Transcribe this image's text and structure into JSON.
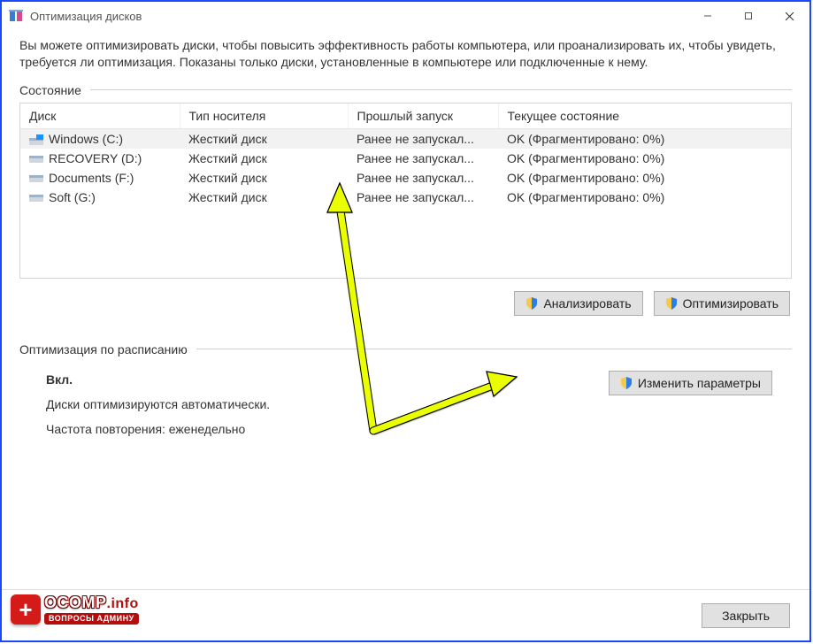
{
  "window": {
    "title": "Оптимизация дисков"
  },
  "description": "Вы можете оптимизировать диски, чтобы повысить эффективность работы  компьютера, или проанализировать их, чтобы увидеть, требуется ли оптимизация. Показаны только диски, установленные в компьютере или подключенные к нему.",
  "sections": {
    "status_label": "Состояние",
    "schedule_label": "Оптимизация по расписанию"
  },
  "table": {
    "headers": {
      "disk": "Диск",
      "media": "Тип носителя",
      "last": "Прошлый запуск",
      "state": "Текущее состояние"
    },
    "rows": [
      {
        "name": "Windows (C:)",
        "media": "Жесткий диск",
        "last": "Ранее не запускал...",
        "state": "OK (Фрагментировано: 0%)",
        "selected": true,
        "accent": true
      },
      {
        "name": "RECOVERY (D:)",
        "media": "Жесткий диск",
        "last": "Ранее не запускал...",
        "state": "OK (Фрагментировано: 0%)",
        "selected": false,
        "accent": false
      },
      {
        "name": "Documents (F:)",
        "media": "Жесткий диск",
        "last": "Ранее не запускал...",
        "state": "OK (Фрагментировано: 0%)",
        "selected": false,
        "accent": false
      },
      {
        "name": "Soft (G:)",
        "media": "Жесткий диск",
        "last": "Ранее не запускал...",
        "state": "OK (Фрагментировано: 0%)",
        "selected": false,
        "accent": false
      }
    ]
  },
  "buttons": {
    "analyze": "Анализировать",
    "optimize": "Оптимизировать",
    "change_settings": "Изменить параметры",
    "close": "Закрыть"
  },
  "schedule": {
    "status": "Вкл.",
    "line1": "Диски оптимизируются автоматически.",
    "line2": "Частота повторения: еженедельно"
  },
  "logo": {
    "name": "OCOMP",
    "suffix": ".info",
    "sub": "ВОПРОСЫ АДМИНУ"
  }
}
